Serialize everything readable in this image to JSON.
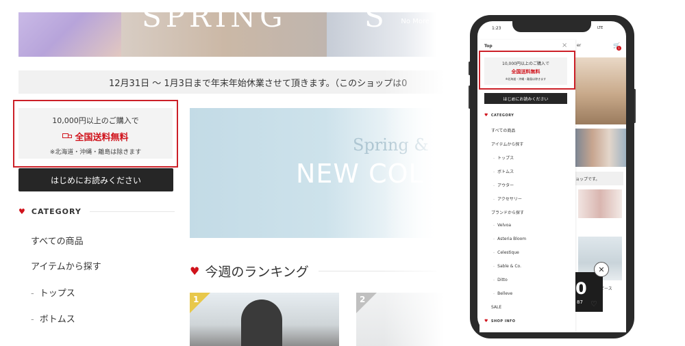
{
  "hero": {
    "letters_left": "SPRING",
    "letters_right": "S",
    "corner_text": "No More"
  },
  "notice": {
    "text": "12月31日 ～ 1月3日まで年末年始休業させて頂きます。（このショップは0"
  },
  "promo": {
    "line1": "10,000円以上のご購入で",
    "line2": "全国送料無料",
    "line3": "※北海道・沖縄・離島は除きます"
  },
  "first_button": "はじめにお読みください",
  "category": {
    "heading": "CATEGORY",
    "items": [
      "すべての商品",
      "アイテムから探す",
      "トップス",
      "ボトムス"
    ],
    "dash": "-"
  },
  "banner": {
    "spring": "Spring &",
    "new_collection": "NEW COL"
  },
  "ranking": {
    "title": "今週のランキング",
    "cards": [
      {
        "rank": "1"
      },
      {
        "rank": "2"
      }
    ]
  },
  "phone": {
    "status_time": "1:23",
    "status_right": "LTE",
    "drawer_top": "Top",
    "close": "×",
    "promo_line1": "10,000円以上のご購入で",
    "promo_line2": "全国送料無料",
    "promo_line3": "※北海道・沖縄・離島は除きます",
    "first_button": "はじめにお読みください",
    "category_heading": "CATEGORY",
    "items": [
      "すべての商品",
      "アイテムから探す",
      "トップス",
      "ボトムス",
      "アウター",
      "アクセサリー",
      "ブランドから探す",
      "Velvoa",
      "Asteria Bloom",
      "Celestique",
      "Sable & Co.",
      "Ditto",
      "Belleve",
      "SALE"
    ],
    "shop_info_heading": "SHOP INFO",
    "right_text": "ョップです。",
    "right_bottom_text": "ピース",
    "dark_big": "0",
    "dark_small": "87",
    "cart_count": "1",
    "logo_text": "er"
  }
}
